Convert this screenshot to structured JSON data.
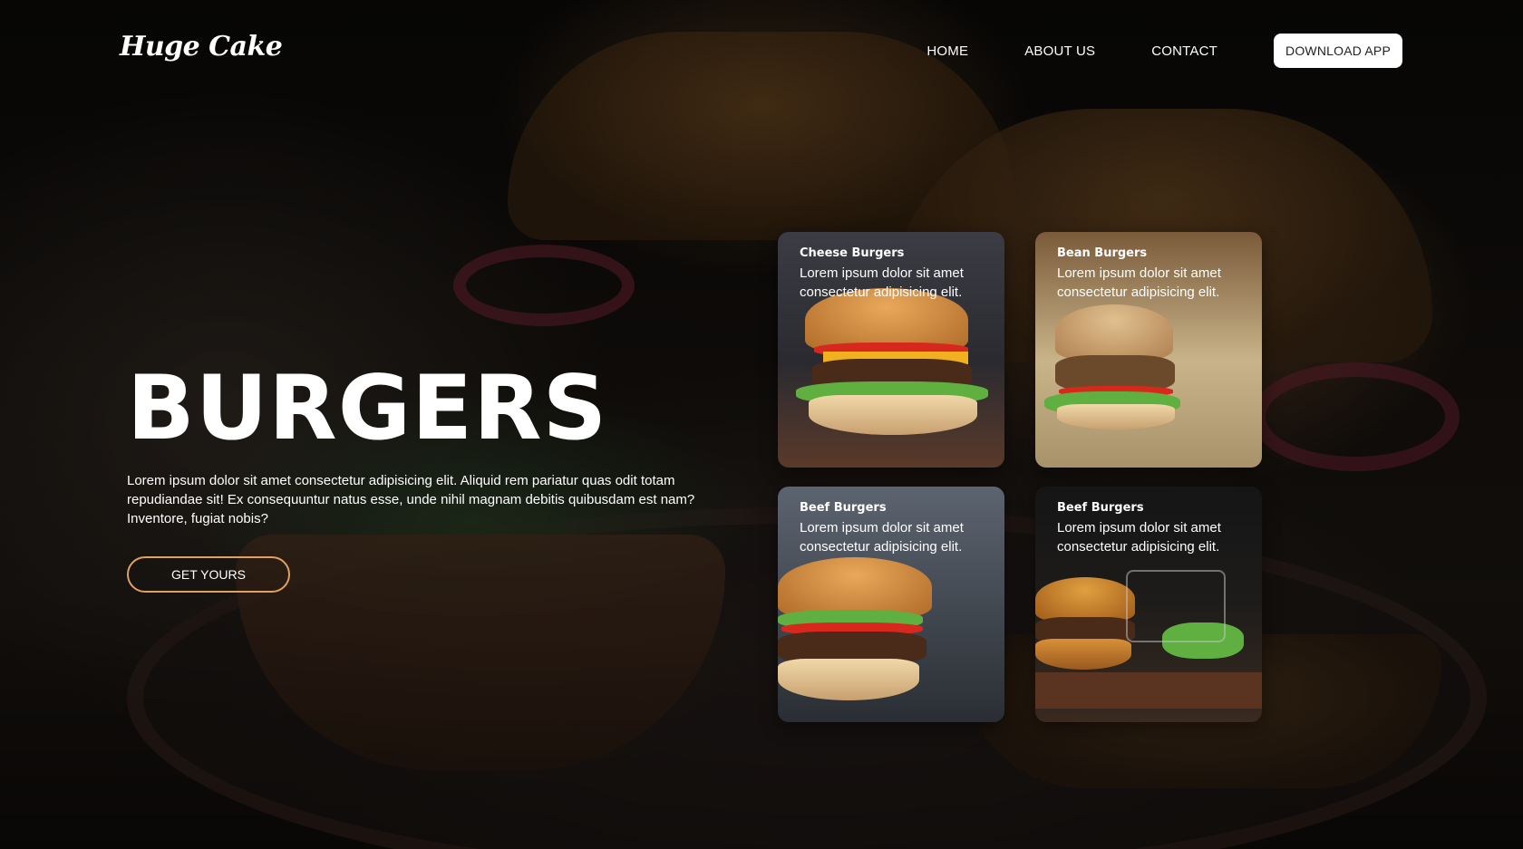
{
  "header": {
    "logo": "Huge Cake",
    "nav": [
      {
        "label": "HOME"
      },
      {
        "label": "ABOUT US"
      },
      {
        "label": "CONTACT"
      }
    ],
    "download_label": "DOWNLOAD APP"
  },
  "hero": {
    "title": "BURGERS",
    "text": "Lorem ipsum dolor sit amet consectetur adipisicing elit. Aliquid rem pariatur quas odit totam repudiandae sit! Ex consequuntur natus esse, unde nihil magnam debitis quibusdam est nam? Inventore, fugiat nobis?",
    "cta_label": "GET YOURS"
  },
  "cards": [
    {
      "title": "Cheese Burgers",
      "desc": "Lorem ipsum dolor sit amet consectetur adipisicing elit."
    },
    {
      "title": "Bean Burgers",
      "desc": "Lorem ipsum dolor sit amet consectetur adipisicing elit."
    },
    {
      "title": "Beef Burgers",
      "desc": "Lorem ipsum dolor sit amet consectetur adipisicing elit."
    },
    {
      "title": "Beef Burgers",
      "desc": "Lorem ipsum dolor sit amet consectetur adipisicing elit."
    }
  ],
  "colors": {
    "accent": "#e0a060",
    "button_bg": "#ffffff"
  }
}
